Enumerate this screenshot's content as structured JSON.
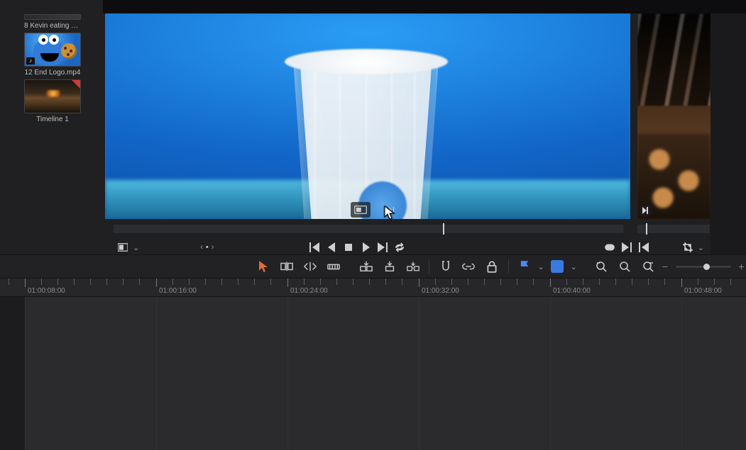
{
  "media_pool": {
    "clips": [
      {
        "label": "8 Kevin eating coo..."
      },
      {
        "label": "12 End Logo.mp4"
      },
      {
        "label": "Timeline 1"
      }
    ]
  },
  "viewer": {
    "overlay": {
      "match_frame": "match-frame",
      "append": "append-at-end"
    }
  },
  "transport": {
    "jump_first": "jump-first",
    "prev_frame": "prev-frame",
    "stop": "stop",
    "play": "play",
    "next_frame": "next-frame",
    "loop": "loop"
  },
  "toolbar": {
    "arrow": "selection",
    "blade": "blade",
    "insert": "insert",
    "ripple": "ripple",
    "swap": "swap-insert",
    "overwrite": "overwrite",
    "replace": "replace",
    "snap": "magnet",
    "link": "link",
    "lock": "lock",
    "flag": "flag",
    "color": "clip-color",
    "search1": "find-prev",
    "search2": "find",
    "search3": "find-next"
  },
  "ruler": {
    "ticks": [
      {
        "pos": 35,
        "label": "01:00:08:00"
      },
      {
        "pos": 220,
        "label": "01:00:16:00"
      },
      {
        "pos": 405,
        "label": "01:00:24:00"
      },
      {
        "pos": 590,
        "label": "01:00:32:00"
      },
      {
        "pos": 775,
        "label": "01:00:40:00"
      },
      {
        "pos": 960,
        "label": "01:00:48:00"
      }
    ]
  }
}
